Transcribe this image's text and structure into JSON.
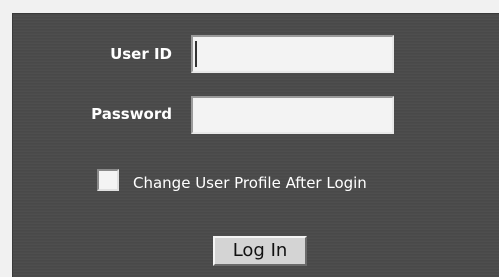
{
  "login_form": {
    "user_id_label": "User ID",
    "user_id_value": "",
    "password_label": "Password",
    "password_value": "",
    "change_profile_label": "Change User Profile After Login",
    "change_profile_checked": false,
    "login_button_label": "Log In"
  },
  "colors": {
    "panel_background": "#4a4a4a",
    "page_background": "#f1f1f1",
    "label_text": "#ffffff",
    "field_background": "#f3f3f3",
    "button_background": "#d4d4d4"
  }
}
